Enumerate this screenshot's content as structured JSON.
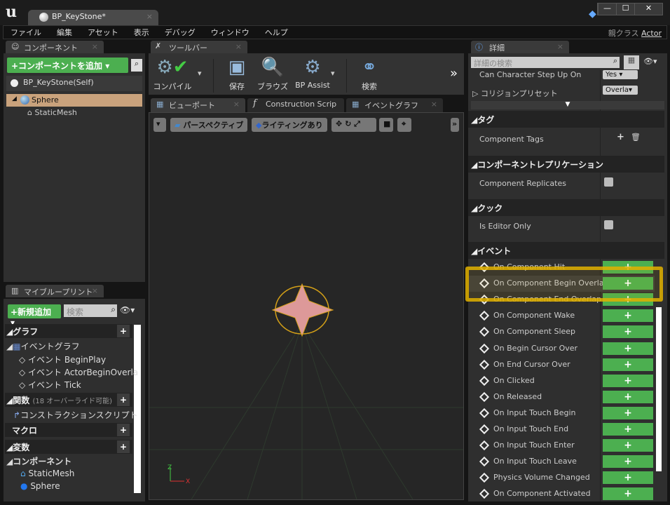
{
  "window": {
    "tab_title": "BP_KeyStone*",
    "parent_class_label": "親クラス",
    "parent_class": "Actor",
    "buttons": [
      "—",
      "☐",
      "✕"
    ]
  },
  "menu": [
    "ファイル",
    "編集",
    "アセット",
    "表示",
    "デバッグ",
    "ウィンドウ",
    "ヘルプ"
  ],
  "components": {
    "tab": "コンポーネント",
    "add_button": "+コンポーネントを追加",
    "root": "BP_KeyStone(Self)",
    "tree": [
      {
        "label": "Sphere",
        "selected": true
      },
      {
        "label": "StaticMesh"
      }
    ]
  },
  "my_blueprint": {
    "tab": "マイブループリント",
    "add_button": "+新規追加",
    "search_placeholder": "検索",
    "sections": {
      "graph": "グラフ",
      "event_graph": "イベントグラフ",
      "events": [
        "イベント BeginPlay",
        "イベント ActorBeginOverla",
        "イベント Tick"
      ],
      "functions": "関数",
      "functions_note": "(18 オーバーライド可能)",
      "construction": "コンストラクションスクリプト",
      "macros": "マクロ",
      "variables": "変数",
      "var_components": "コンポーネント",
      "var_items": [
        "StaticMesh",
        "Sphere"
      ]
    }
  },
  "toolbar": {
    "tab": "ツールバー",
    "buttons": [
      "コンパイル",
      "保存",
      "ブラウズ",
      "BP Assist",
      "検索"
    ]
  },
  "editor_tabs": [
    "ビューポート",
    "Construction Scrip",
    "イベントグラフ"
  ],
  "viewport": {
    "perspective": "パースペクティブ",
    "lighting": "ライティングあり",
    "axis_x": "X",
    "axis_z": "Z"
  },
  "details": {
    "tab": "詳細",
    "search_placeholder": "詳細の検索",
    "can_step_label": "Can Character Step Up On",
    "can_step_value": "Yes",
    "collision_label": "コリジョンプリセット",
    "collision_value": "Overla",
    "tags_header": "タグ",
    "component_tags": "Component Tags",
    "replication_header": "コンポーネントレプリケーション",
    "component_replicates": "Component Replicates",
    "cook_header": "クック",
    "is_editor_only": "Is Editor Only",
    "events_header": "イベント",
    "events": [
      "On Component Hit",
      "On Component Begin Overlap",
      "On Component End Overlap",
      "On Component Wake",
      "On Component Sleep",
      "On Begin Cursor Over",
      "On End Cursor Over",
      "On Clicked",
      "On Released",
      "On Input Touch Begin",
      "On Input Touch End",
      "On Input Touch Enter",
      "On Input Touch Leave",
      "Physics Volume Changed",
      "On Component Activated"
    ],
    "add_glyph": "+"
  },
  "colors": {
    "accent_green": "#4caf50",
    "selection": "#c9a27c",
    "highlight": "#e0b000"
  }
}
